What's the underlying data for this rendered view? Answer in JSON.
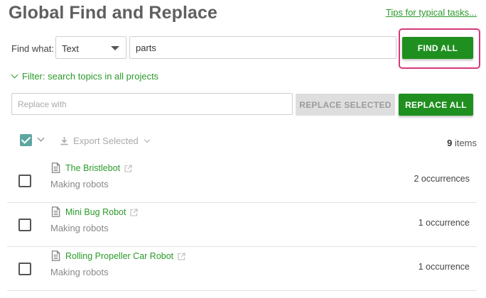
{
  "header": {
    "title": "Global Find and Replace",
    "tips_link": "Tips for typical tasks..."
  },
  "find": {
    "label": "Find what:",
    "type_value": "Text",
    "query_value": "parts",
    "find_all_label": "FIND ALL"
  },
  "filter": {
    "label": "Filter: search topics in all projects"
  },
  "replace": {
    "placeholder": "Replace with",
    "replace_selected_label": "REPLACE SELECTED",
    "replace_all_label": "REPLACE ALL"
  },
  "results_toolbar": {
    "export_label": "Export Selected",
    "items_count": "9",
    "items_suffix": " items"
  },
  "results": [
    {
      "title": "The Bristlebot",
      "project": "Making robots",
      "occurrences": "2 occurrences"
    },
    {
      "title": "Mini Bug Robot",
      "project": "Making robots",
      "occurrences": "1 occurrence"
    },
    {
      "title": "Rolling Propeller Car Robot",
      "project": "Making robots",
      "occurrences": "1 occurrence"
    }
  ],
  "colors": {
    "accent_green": "#1f8f1f",
    "link_green": "#2a9a2a",
    "highlight_frame": "#d63a7a",
    "checkbox_teal": "#5fa6a0"
  },
  "icons": {
    "row_icon": "document-icon",
    "row_link_icon": "external-link-icon",
    "export_icon": "download-icon"
  }
}
